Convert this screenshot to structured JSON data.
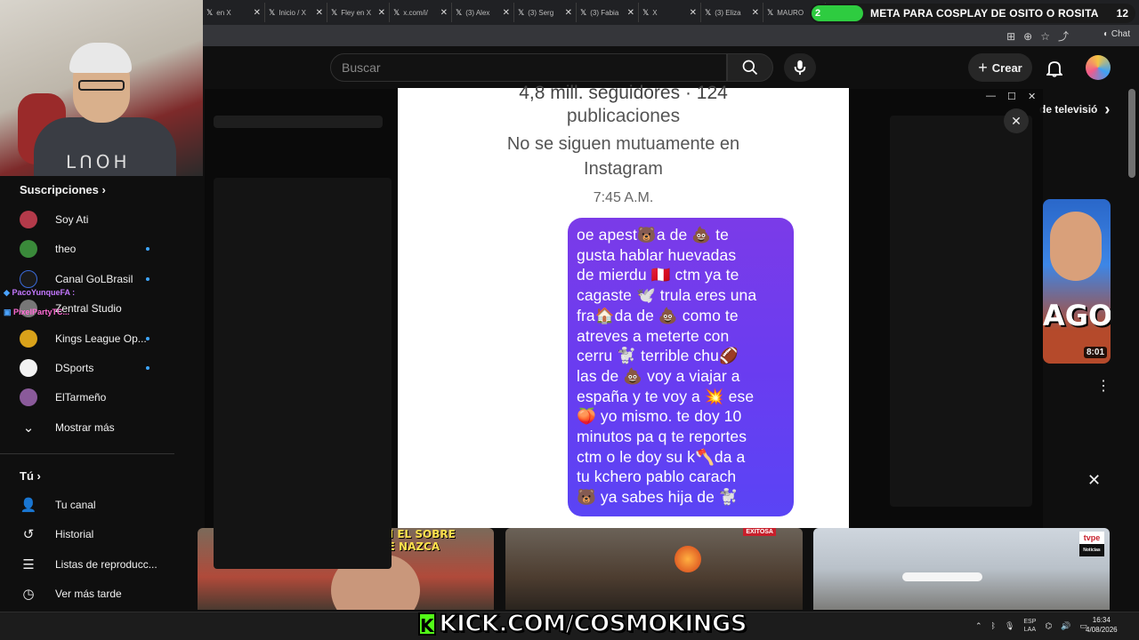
{
  "browser": {
    "tabs": [
      {
        "label": "en X"
      },
      {
        "label": "Inicio / X"
      },
      {
        "label": "Fley en X"
      },
      {
        "label": "x.com/i/"
      },
      {
        "label": "(3) Alex"
      },
      {
        "label": "(3) Serg"
      },
      {
        "label": "(3) Fabia"
      },
      {
        "label": "X"
      },
      {
        "label": "(3) Eliza"
      },
      {
        "label": "MAURO"
      }
    ],
    "chat_label": "Chat"
  },
  "stream_goal": {
    "count": "2",
    "label": "META PARA COSPLAY DE OSITO O ROSITA",
    "target": "12"
  },
  "youtube": {
    "search_placeholder": "Buscar",
    "create_label": "Crear",
    "feed_chip": "de televisió"
  },
  "sidebar": {
    "subscriptions_title": "Suscripciones",
    "subscriptions": [
      {
        "label": "Soy Ati",
        "color": "#b33a4a",
        "live": false
      },
      {
        "label": "theo",
        "color": "#3a8a3a",
        "live": true
      },
      {
        "label": "Canal GoLBrasil",
        "color": "#1a1a1a",
        "live": true
      },
      {
        "label": "Zentral Studio",
        "color": "#777777",
        "live": false
      },
      {
        "label": "Kings League Op...",
        "color": "#d9a21a",
        "live": true
      },
      {
        "label": "DSports",
        "color": "#f2f2f2",
        "live": true
      },
      {
        "label": "ElTarmeño",
        "color": "#8a5a9a",
        "live": false
      }
    ],
    "show_more": "Mostrar más",
    "you_title": "Tú",
    "you_items": [
      {
        "label": "Tu canal",
        "icon": "person-icon"
      },
      {
        "label": "Historial",
        "icon": "history-icon"
      },
      {
        "label": "Listas de reproducc...",
        "icon": "playlist-icon"
      },
      {
        "label": "Ver más tarde",
        "icon": "clock-icon"
      }
    ]
  },
  "chat_overlay": {
    "user1": "PacoYunqueFA :",
    "user2": "PixelPartyTC..."
  },
  "instagram_screenshot": {
    "stats": "4,8 mill. seguidores · 124",
    "stats2": "publicaciones",
    "mutual_line1": "No se siguen mutuamente en",
    "mutual_line2": "Instagram",
    "time": "7:45 A.M.",
    "message_lines": [
      "oe apest🐻a de 💩 te",
      "gusta hablar huevadas",
      "de mierdu 🇵🇪 ctm ya te",
      "cagaste 🕊️ trula eres una",
      "fra🏠da de 💩 como te",
      "atreves a meterte con",
      "cerru 🐩 terrible chu🏈",
      "las de 💩 voy a viajar a",
      "españa y te voy a 💥 ese",
      "🍑 yo mismo. te doy 10",
      "minutos pa q te reportes",
      "ctm o le doy su k🪓da a",
      "tu kchero pablo carach",
      "🐻 ya sabes hija de 🐩"
    ]
  },
  "right_feed": {
    "thumb_text": "AGO",
    "duration": "8:01"
  },
  "bottom_thumbs": {
    "caption1": "HAY UN CRECIMIENTO EN EL SOBRE VUELO A LAS LINEA DE NAZCA",
    "tag2": "EXITOSA",
    "logo3": "tvpe",
    "logo3_sub": "Noticias"
  },
  "overlay": {
    "kick_url": "KICK.COM/COSMOKINGS"
  },
  "taskbar": {
    "lang1": "ESP",
    "lang2": "LAA",
    "time": "16:34",
    "date": "4/08/2026"
  }
}
